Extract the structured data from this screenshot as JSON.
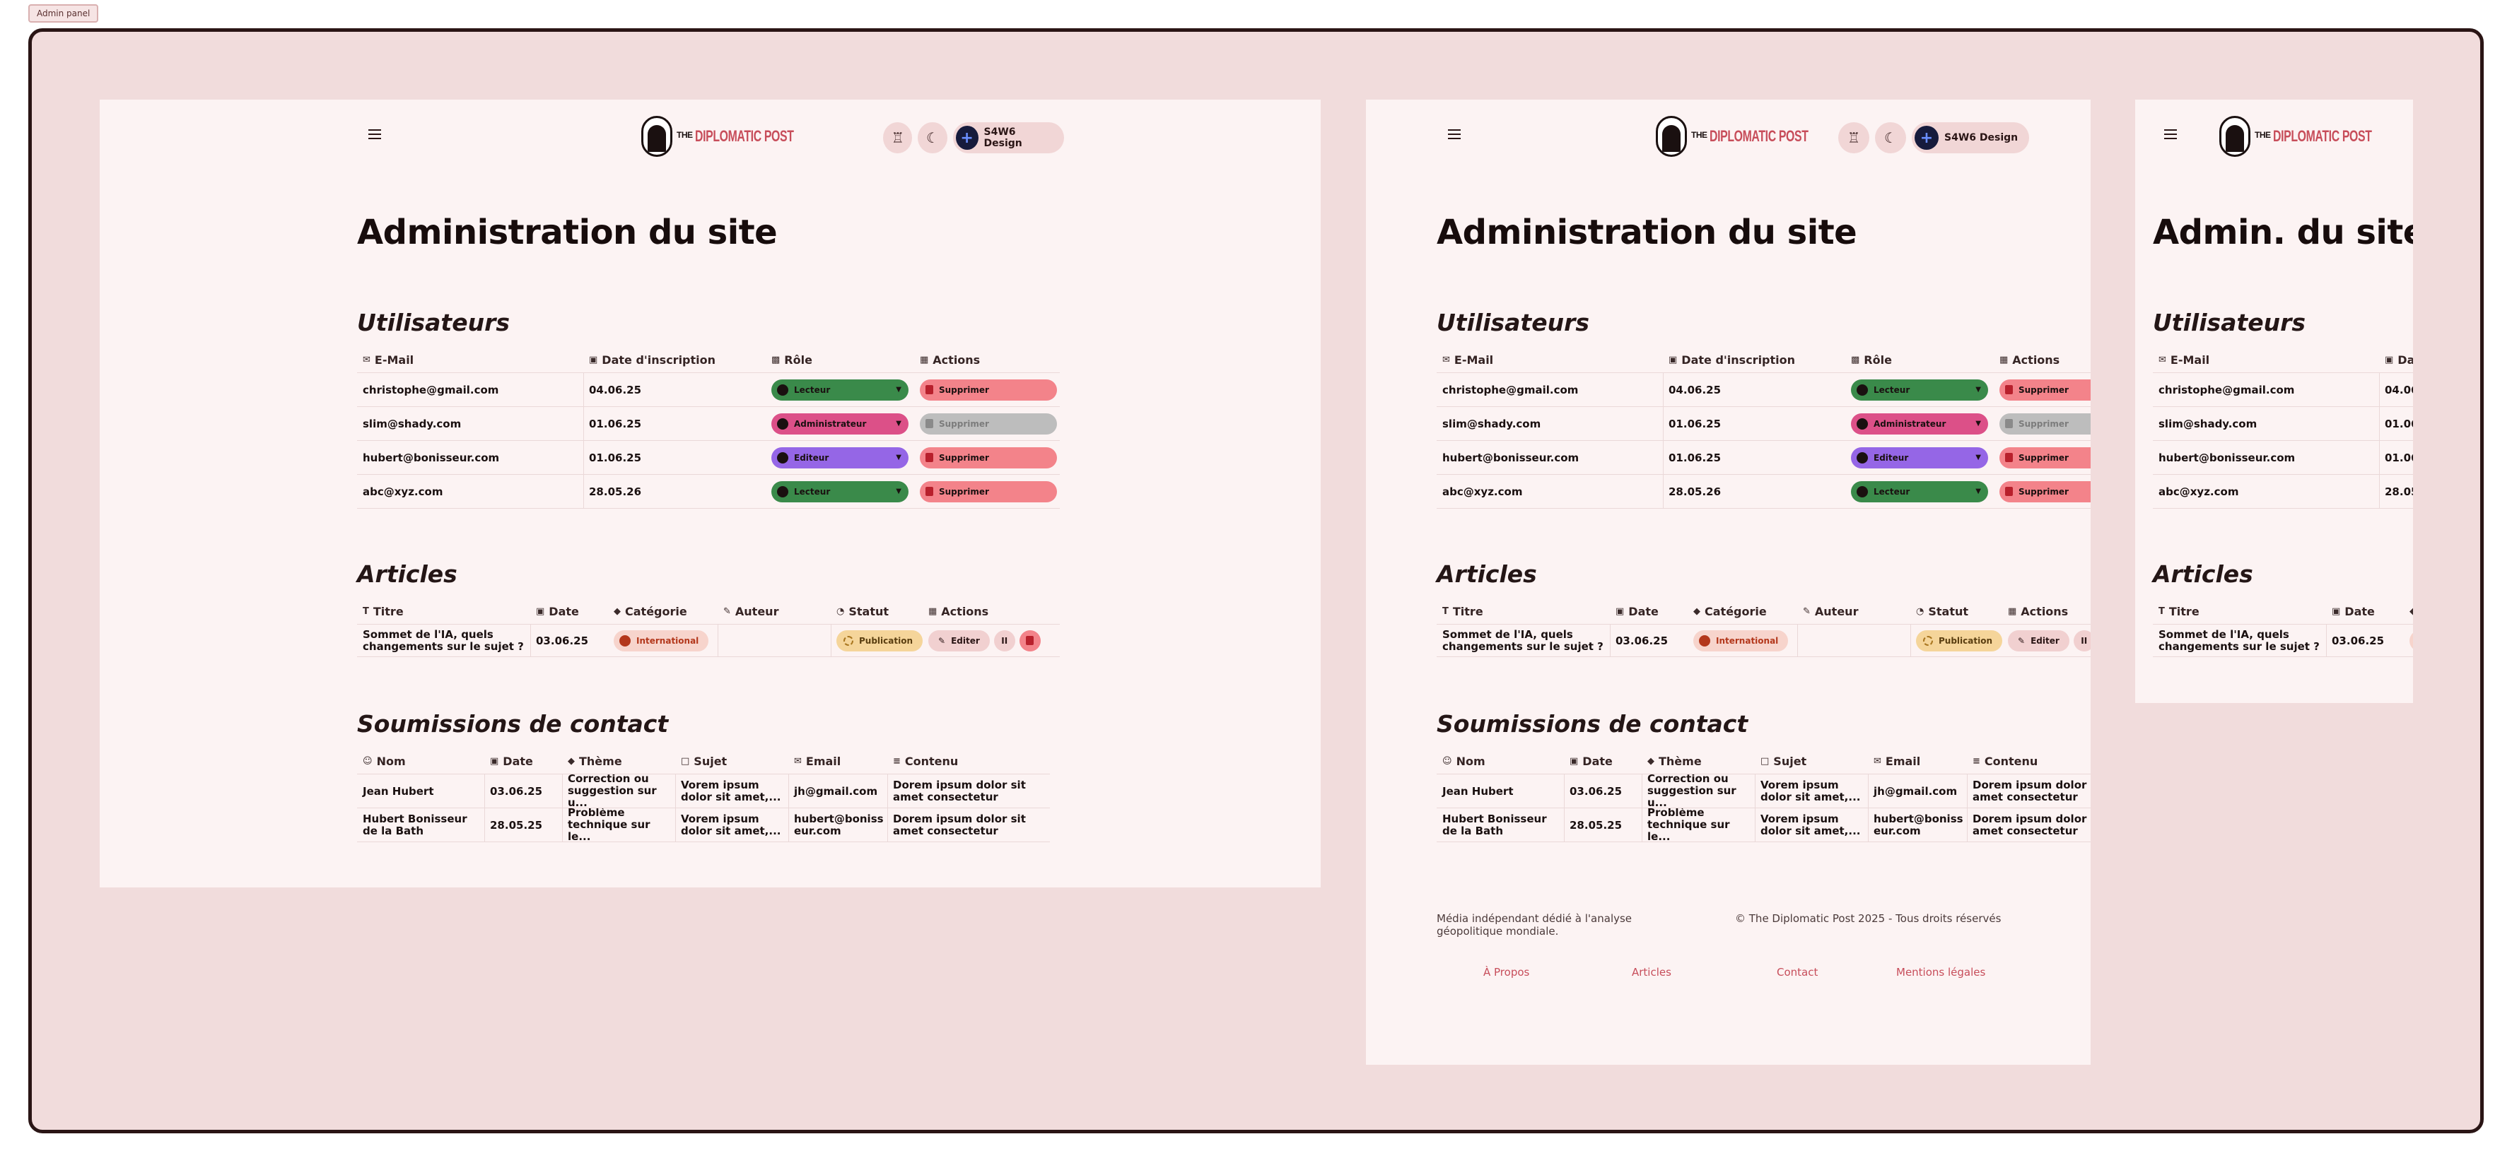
{
  "corner_tag": "Admin panel",
  "brand": {
    "the": "THE",
    "name": "DIPLOMATIC POST"
  },
  "header": {
    "user_name": "S4W6 Design",
    "user_avatar_icon": "plus-icon",
    "award_icon": "award-icon",
    "theme_icon": "moon-icon"
  },
  "colors": {
    "accent": "#c74d5a",
    "lecteur": "#3a8a4a",
    "administrateur": "#dc5088",
    "editeur": "#9566e6",
    "supprimer": "#f3838a"
  },
  "page_title": "Administration du site",
  "page_title_short": "Admin. du site",
  "users": {
    "title": "Utilisateurs",
    "headers": {
      "email": "E-Mail",
      "date": "Date d'inscription",
      "role": "Rôle",
      "actions": "Actions"
    },
    "rows": [
      {
        "email": "christophe@gmail.com",
        "date": "04.06.25",
        "role": "Lecteur",
        "action": "Supprimer"
      },
      {
        "email": "slim@shady.com",
        "date": "01.06.25",
        "role": "Administrateur",
        "action": "Supprimer"
      },
      {
        "email": "hubert@bonisseur.com",
        "date": "01.06.25",
        "role": "Editeur",
        "action": "Supprimer"
      },
      {
        "email": "abc@xyz.com",
        "date": "28.05.26",
        "role": "Lecteur",
        "action": "Supprimer"
      }
    ]
  },
  "articles": {
    "title": "Articles",
    "headers": {
      "titre": "Titre",
      "date": "Date",
      "categorie": "Catégorie",
      "auteur": "Auteur",
      "statut": "Statut",
      "actions": "Actions"
    },
    "rows": [
      {
        "titre": "Sommet de l'IA, quels changements sur le sujet ?",
        "date": "03.06.25",
        "categorie": "International",
        "auteur": "",
        "statut": "Publication",
        "edit": "Editer",
        "pause": "II"
      }
    ]
  },
  "contact": {
    "title": "Soumissions de contact",
    "headers": {
      "nom": "Nom",
      "date": "Date",
      "theme": "Thème",
      "sujet": "Sujet",
      "email": "Email",
      "contenu": "Contenu"
    },
    "rows": [
      {
        "nom": "Jean Hubert",
        "date": "03.06.25",
        "theme": "Correction ou suggestion sur u...",
        "sujet": "Vorem ipsum dolor sit amet,...",
        "email": "jh@gmail.com",
        "contenu": "Dorem ipsum dolor sit amet consectetur"
      },
      {
        "nom": "Hubert Bonisseur de la Bath",
        "date": "28.05.25",
        "theme": "Problème technique sur le...",
        "sujet": "Vorem ipsum dolor sit amet,...",
        "email": "hubert@bonisseur.com",
        "contenu": "Dorem ipsum dolor sit amet consectetur"
      }
    ]
  },
  "footer": {
    "tagline": "Média indépendant dédié à l'analyse géopolitique mondiale.",
    "copyright": "© The Diplomatic Post 2025 - Tous droits réservés",
    "links": [
      "À Propos",
      "Articles",
      "Contact",
      "Mentions légales"
    ]
  }
}
